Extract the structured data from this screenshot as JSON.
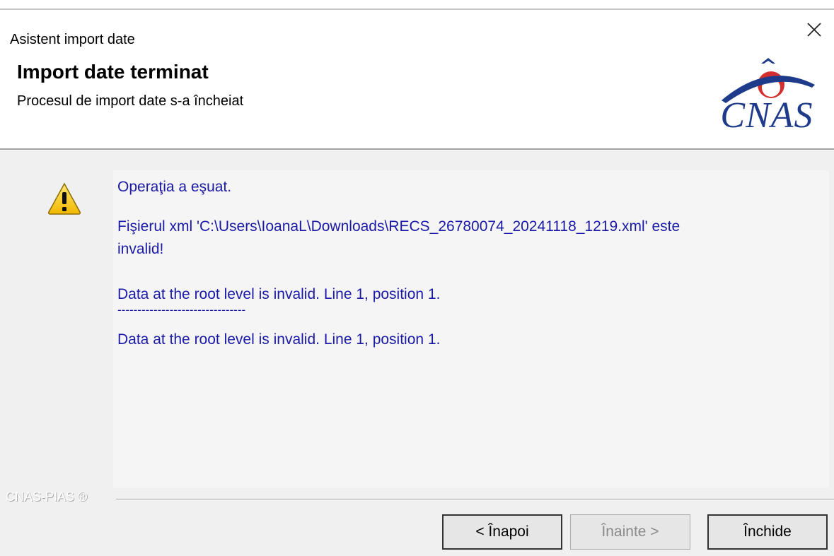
{
  "window": {
    "title": "Asistent import date",
    "close_symbol": "✕"
  },
  "header": {
    "title": "Import date terminat",
    "subtitle": "Procesul de import date s-a încheiat",
    "logo_text": "CNAS",
    "logo_colors": {
      "text": "#1e3a8a",
      "accent": "#d32f2f"
    }
  },
  "message": {
    "icon": "warning-icon",
    "lines": [
      "Operaţia a eşuat.",
      "Fişierul xml 'C:\\Users\\IoanaL\\Downloads\\RECS_26780074_20241118_1219.xml' este",
      "invalid!",
      "Data at the root level is invalid. Line 1, position 1.",
      "--------------------------------",
      "Data at the root level is invalid. Line 1, position 1."
    ],
    "text_color": "#1a1aa6"
  },
  "footer": {
    "brand": "CNAS-PIAS ®",
    "buttons": {
      "back": "< Înapoi",
      "next": "Înainte >",
      "close": "Închide"
    }
  }
}
